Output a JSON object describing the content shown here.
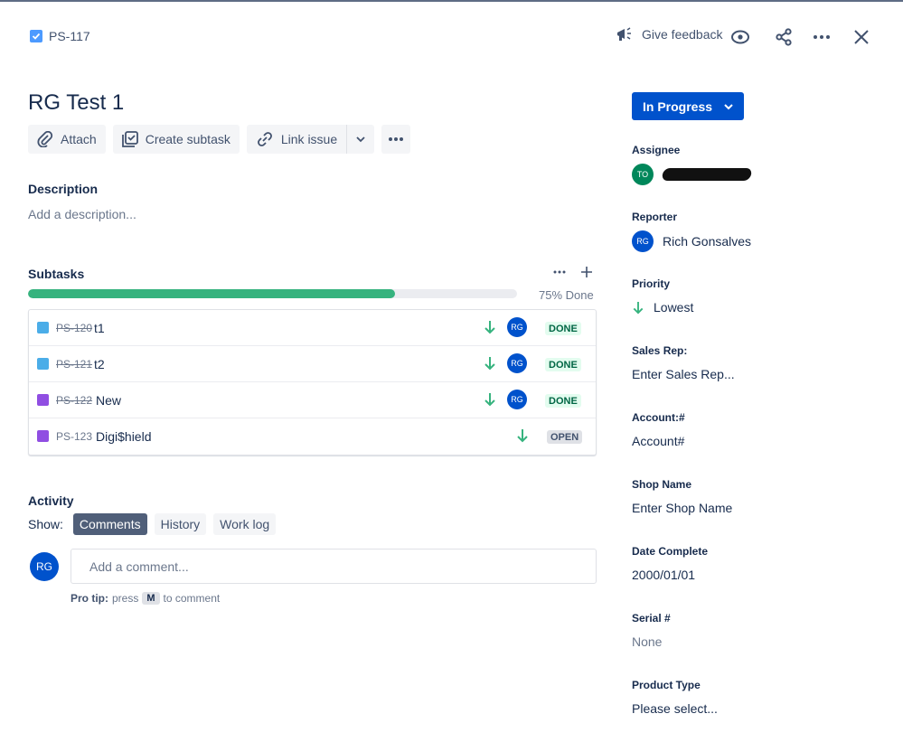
{
  "header": {
    "issue_key": "PS-117",
    "feedback_label": "Give feedback"
  },
  "issue": {
    "title": "RG Test 1"
  },
  "toolbar": {
    "attach": "Attach",
    "create_subtask": "Create subtask",
    "link_issue": "Link issue"
  },
  "description": {
    "label": "Description",
    "placeholder": "Add a description..."
  },
  "subtasks": {
    "label": "Subtasks",
    "progress": 0.75,
    "progress_label": "75% Done",
    "items": [
      {
        "key": "PS-120",
        "summary": "t1",
        "type": "subtask",
        "priority": "lowest",
        "assignee": "RG",
        "status": "DONE"
      },
      {
        "key": "PS-121",
        "summary": "t2",
        "type": "subtask",
        "priority": "lowest",
        "assignee": "RG",
        "status": "DONE"
      },
      {
        "key": "PS-122",
        "summary": "New",
        "type": "story",
        "priority": "lowest",
        "assignee": "RG",
        "status": "DONE"
      },
      {
        "key": "PS-123",
        "summary": "Digi$hield",
        "type": "story",
        "priority": "lowest",
        "assignee": "",
        "status": "OPEN"
      }
    ]
  },
  "activity": {
    "label": "Activity",
    "show_label": "Show:",
    "filters": [
      "Comments",
      "History",
      "Work log"
    ],
    "active_filter": "Comments",
    "user_initials": "RG",
    "comment_placeholder": "Add a comment...",
    "pro_tip_label": "Pro tip:",
    "pro_tip_press": "press",
    "pro_tip_key": "M",
    "pro_tip_suffix": "to comment"
  },
  "sidebar": {
    "status": "In Progress",
    "assignee_label": "Assignee",
    "assignee_initials": "TO",
    "reporter_label": "Reporter",
    "reporter_initials": "RG",
    "reporter_name": "Rich Gonsalves",
    "priority_label": "Priority",
    "priority_value": "Lowest",
    "sales_rep_label": "Sales Rep:",
    "sales_rep_value": "Enter Sales Rep...",
    "account_label": "Account:#",
    "account_value": "Account#",
    "shop_name_label": "Shop Name",
    "shop_name_value": "Enter Shop Name",
    "date_complete_label": "Date Complete",
    "date_complete_value": "2000/01/01",
    "serial_label": "Serial #",
    "serial_value": "None",
    "product_type_label": "Product Type",
    "product_type_value": "Please select..."
  },
  "colors": {
    "primary": "#0052cc",
    "progress": "#36b37e",
    "done_lozenge_bg": "#e3fcef",
    "done_lozenge_text": "#006644",
    "priority_lowest": "#36b37e",
    "assignee_avatar": "#00875a"
  }
}
